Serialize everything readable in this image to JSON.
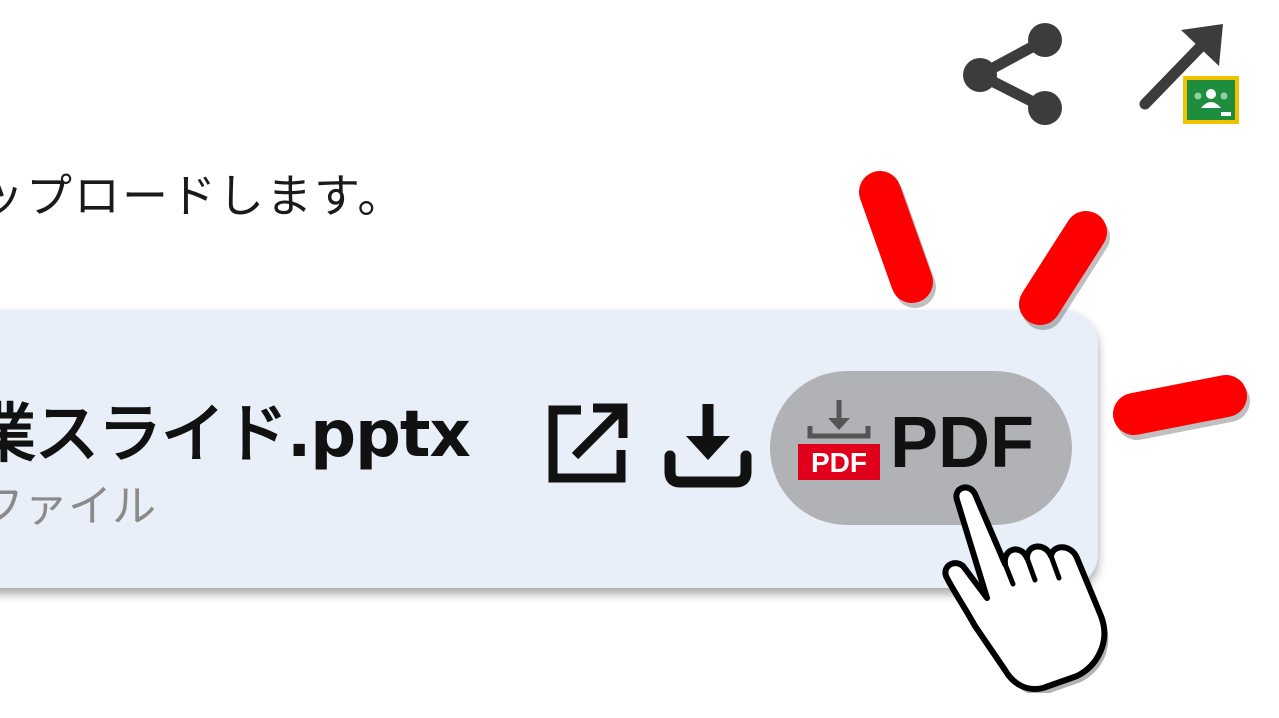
{
  "toolbar": {
    "share_icon": "share-icon",
    "classroom_share_icon": "share-to-classroom-icon"
  },
  "instruction": "ップロードします。",
  "file": {
    "name": "業スライド.pptx",
    "type_label": "ファイル",
    "open_icon": "open-in-new-icon",
    "download_icon": "download-icon"
  },
  "pdf_button": {
    "label": "PDF",
    "badge_text": "PDF",
    "icon": "pdf-download-icon"
  },
  "colors": {
    "card_background": "#e8eff8",
    "pdf_button_background": "#b0b2b6",
    "emphasis_red": "#ff0000",
    "classroom_green": "#1e8e3e",
    "classroom_yellow": "#f2c200",
    "pdf_red": "#e0001b"
  },
  "overlay": {
    "pointer": "hand-pointer-icon",
    "emphasis": "red-emphasis-marks"
  }
}
